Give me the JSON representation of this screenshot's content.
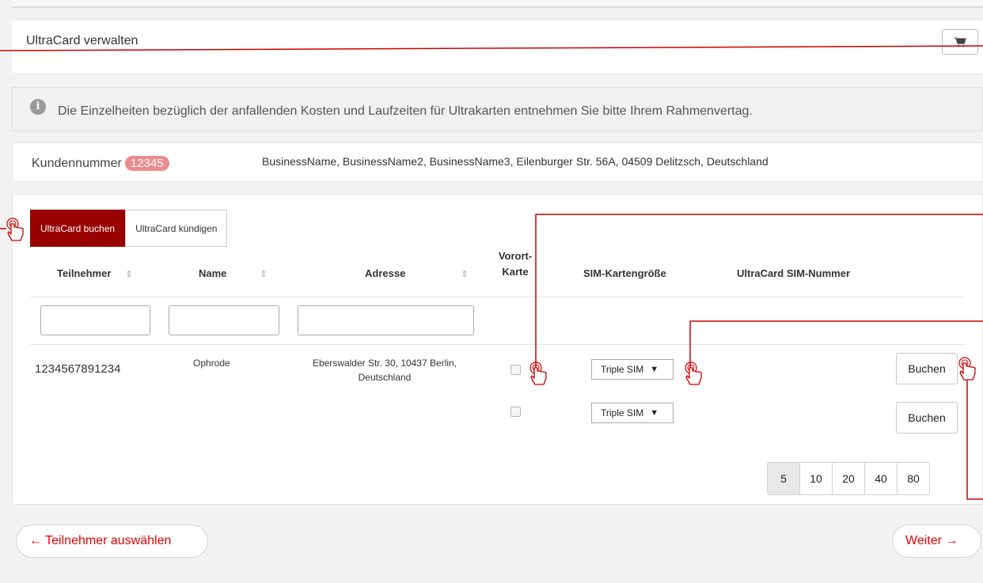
{
  "page": {
    "title": "UltraCard verwalten",
    "cart_icon": "cart-icon"
  },
  "info": {
    "icon": "info-icon",
    "text": "Die Einzelheiten bezüglich der anfallenden Kosten und Laufzeiten für Ultrakarten entnehmen Sie bitte Ihrem Rahmenvertag."
  },
  "customer": {
    "label": "Kundennummer",
    "number": "12345",
    "address": "BusinessName, BusinessName2, BusinessName3, Eilenburger Str. 56A, 04509 Delitzsch, Deutschland"
  },
  "tabs": [
    {
      "label": "UltraCard buchen",
      "active": true
    },
    {
      "label": "UltraCard kündigen",
      "active": false
    }
  ],
  "table": {
    "headers": {
      "teilnehmer": "Teilnehmer",
      "name": "Name",
      "adresse": "Adresse",
      "vorort_line1": "Vorort-",
      "vorort_line2": "Karte",
      "sim_size": "SIM-Kartengröße",
      "sim_number": "UltraCard SIM-Nummer"
    },
    "sort_icon": "⇕",
    "filters": {
      "teilnehmer": "",
      "name": "",
      "adresse": ""
    },
    "row": {
      "teilnehmer": "1234567891234",
      "name": "Ophrode",
      "address_line1": "Eberswalder Str. 30, 10437 Berlin,",
      "address_line2": "Deutschland"
    },
    "sims": [
      {
        "size": "Triple SIM",
        "vorort": false,
        "button": "Buchen"
      },
      {
        "size": "Triple SIM",
        "vorort": false,
        "button": "Buchen"
      }
    ],
    "select_arrow": "▼"
  },
  "pagination": {
    "sizes": [
      "5",
      "10",
      "20",
      "40",
      "80"
    ],
    "active": "5"
  },
  "nav": {
    "back": "← Teilnehmer auswählen",
    "next": "Weiter →"
  },
  "colors": {
    "accent": "#990000",
    "link": "#e60000",
    "callout": "#cc0000",
    "badge": "#ec8b8b"
  }
}
